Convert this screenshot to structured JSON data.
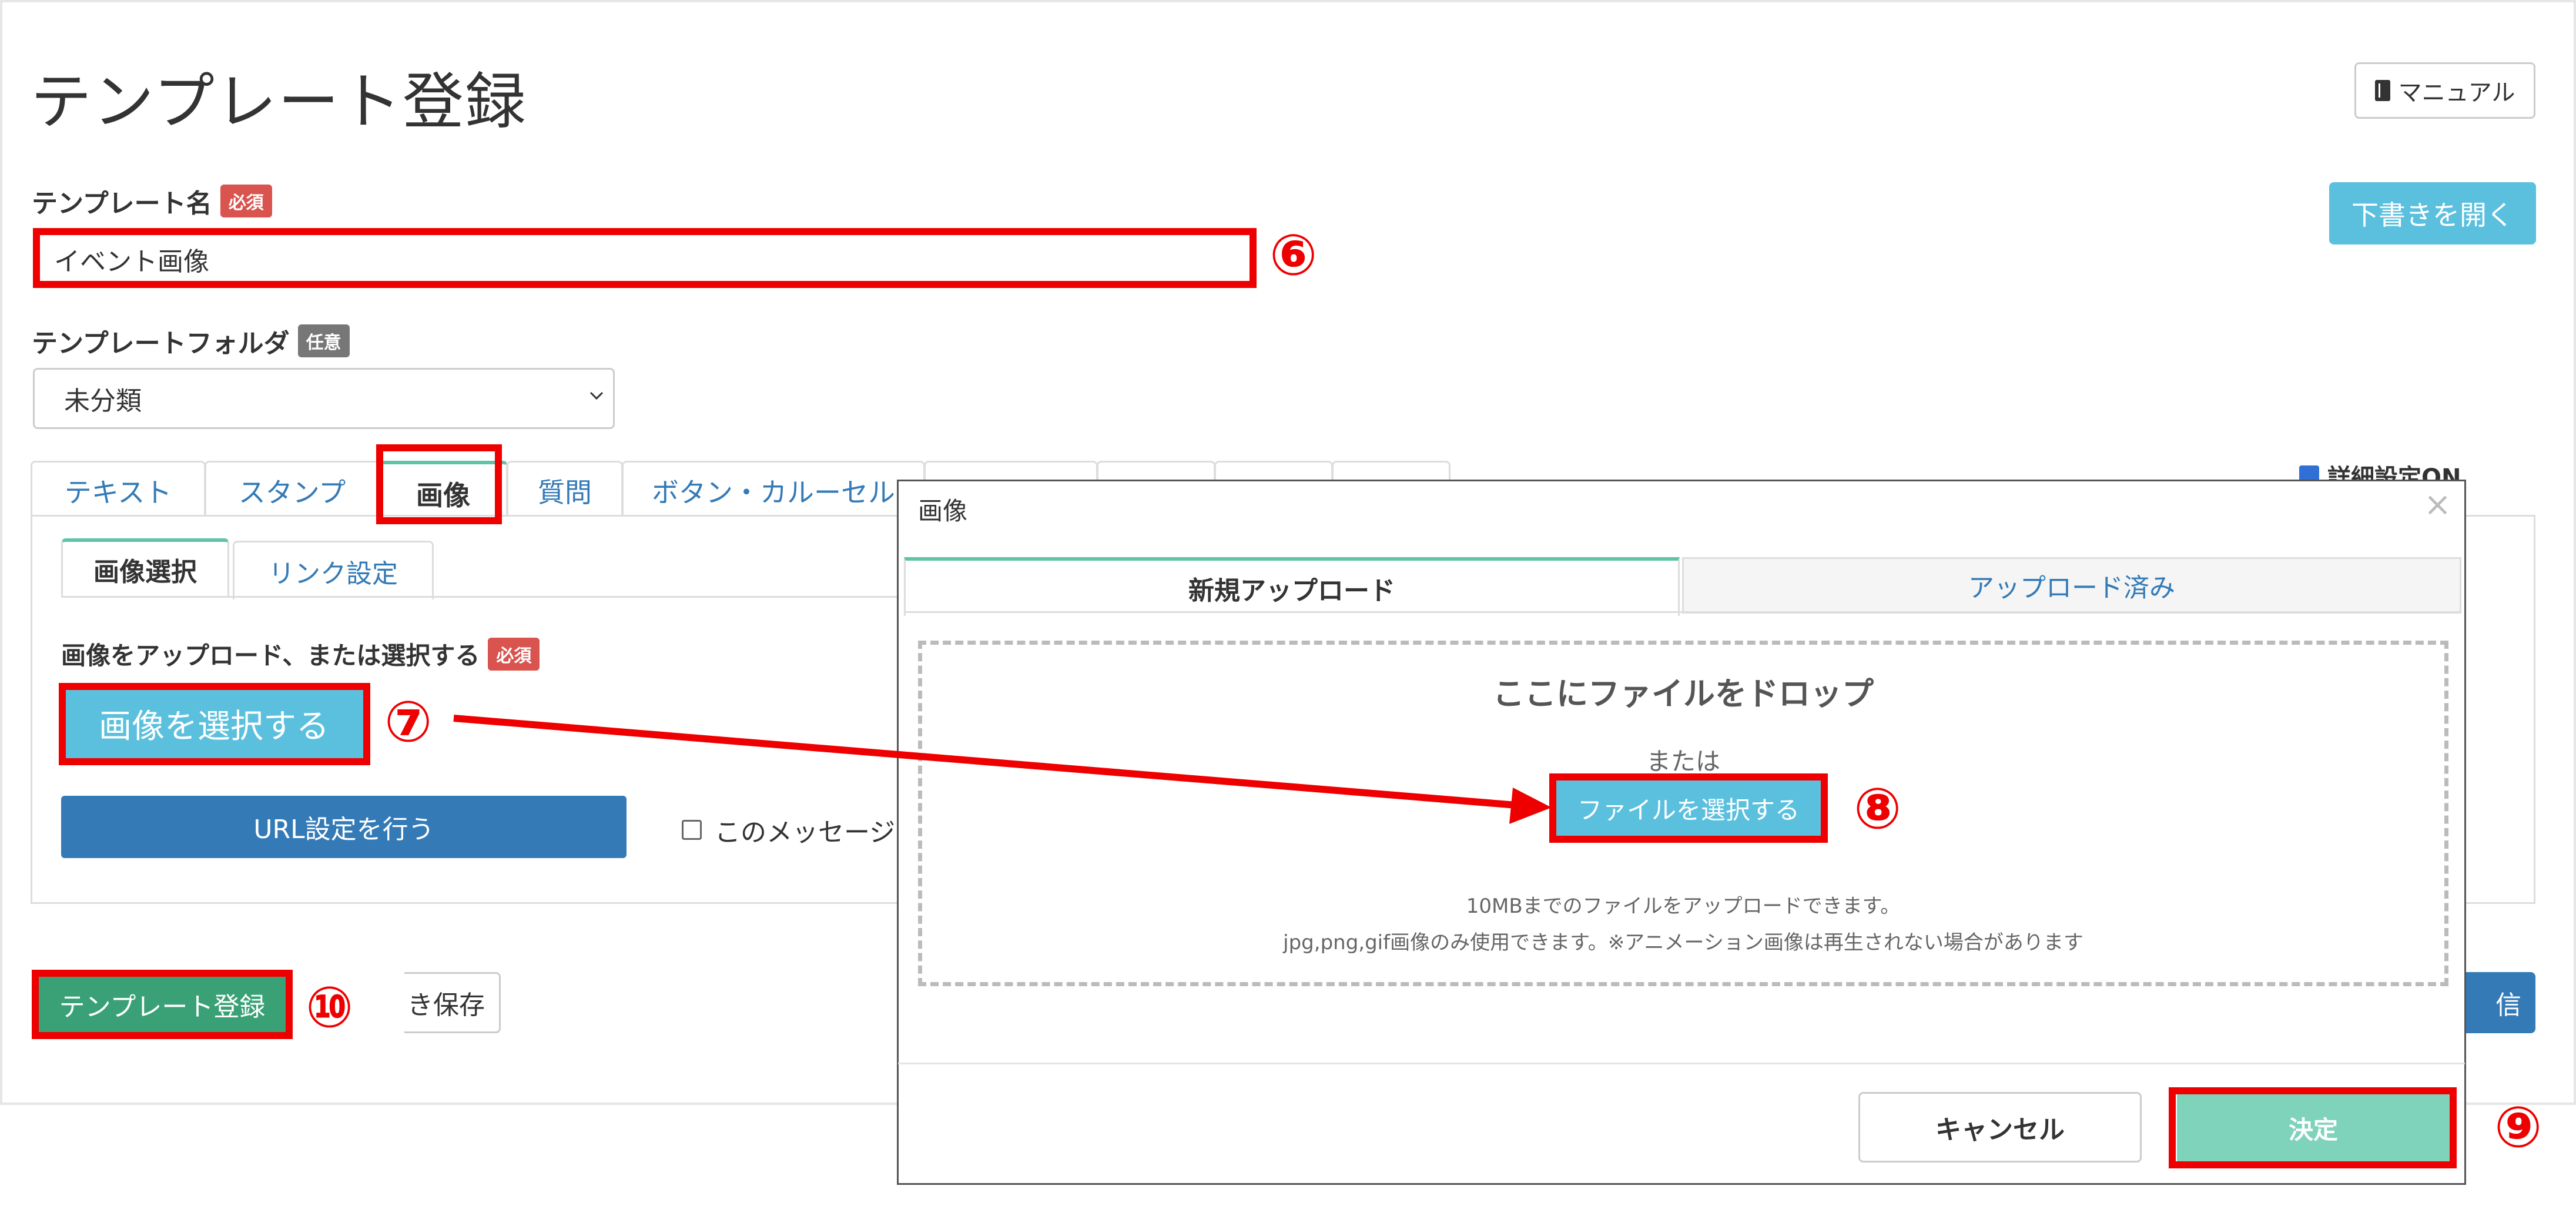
{
  "page": {
    "title": "テンプレート登録",
    "manual_label": "マニュアル",
    "open_draft_label": "下書きを開く"
  },
  "form": {
    "name_label": "テンプレート名",
    "required_badge": "必須",
    "name_value": "イベント画像",
    "folder_label": "テンプレートフォルダ",
    "optional_badge": "任意",
    "folder_value": "未分類"
  },
  "tabs": [
    {
      "label": "テキスト"
    },
    {
      "label": "スタンプ"
    },
    {
      "label": "画像"
    },
    {
      "label": "質問"
    },
    {
      "label": "ボタン・カルーセル"
    }
  ],
  "advanced_toggle_label": "詳細設定ON",
  "image_tab": {
    "subtabs": [
      {
        "label": "画像選択"
      },
      {
        "label": "リンク設定"
      }
    ],
    "upload_label": "画像をアップロード、または選択する",
    "required_badge": "必須",
    "select_image_button": "画像を選択する",
    "url_button": "URL設定を行う",
    "message_checkbox_label": "このメッセージ"
  },
  "footer": {
    "register_button": "テンプレート登録",
    "draft_save_button": "き保存",
    "send_button": "信"
  },
  "modal": {
    "title": "画像",
    "close_glyph": "×",
    "tabs": [
      {
        "label": "新規アップロード"
      },
      {
        "label": "アップロード済み"
      }
    ],
    "drop_title": "ここにファイルをドロップ",
    "or_text": "または",
    "file_button": "ファイルを選択する",
    "note_size": "10MBまでのファイルをアップロードできます。",
    "note_types": "jpg,png,gif画像のみ使用できます。※アニメーション画像は再生されない場合があります",
    "cancel_button": "キャンセル",
    "ok_button": "決定"
  },
  "annotations": {
    "step6": "⑥",
    "step7": "⑦",
    "step8": "⑧",
    "step9": "⑨",
    "step10": "⑩",
    "color": "#ee0000"
  }
}
